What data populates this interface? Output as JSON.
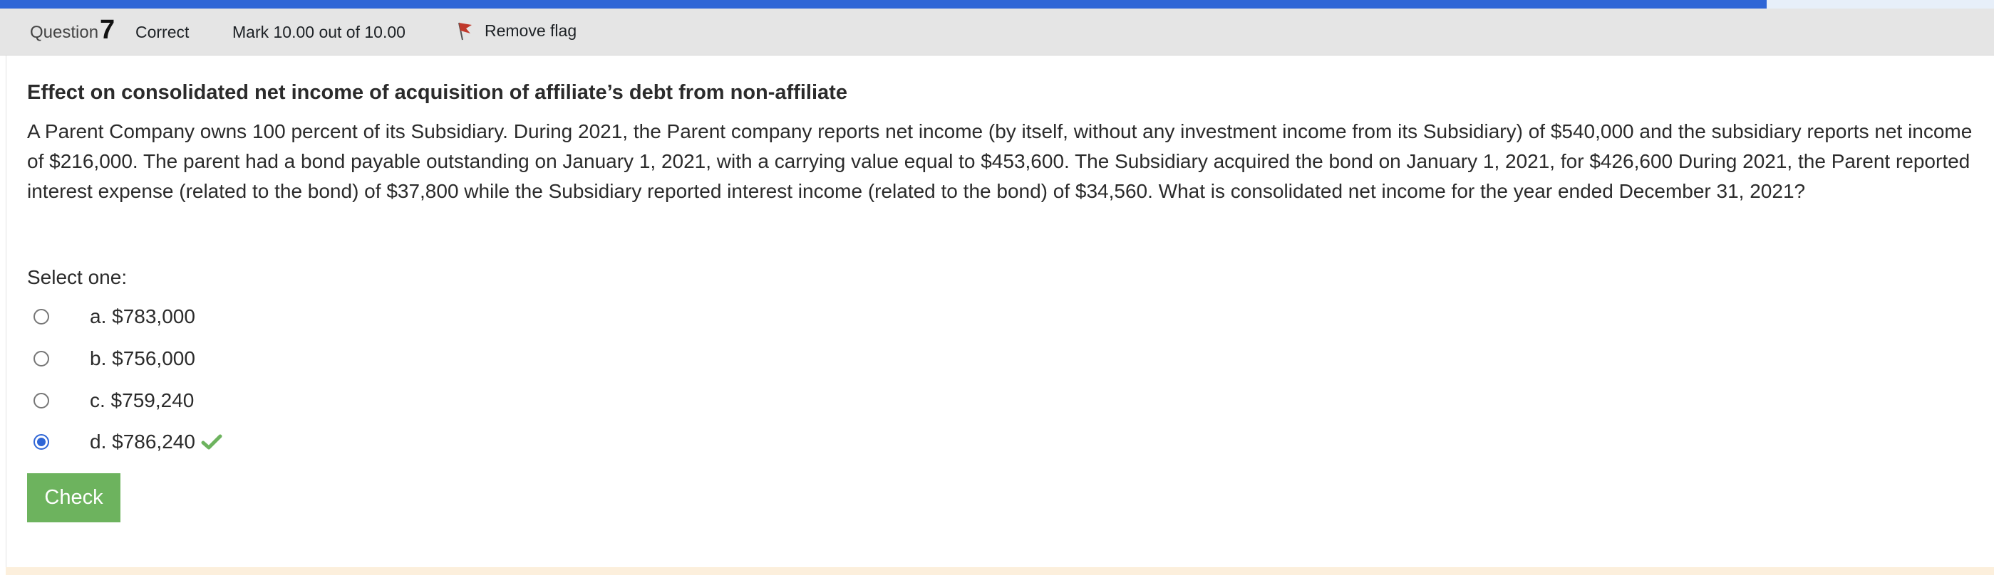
{
  "colors": {
    "accent_blue": "#2f66d6",
    "info_bar_bg": "#e5e5e5",
    "correct_green": "#6db35e",
    "feedback_band": "#fcefdc"
  },
  "progress": {
    "fraction": 0.886
  },
  "info": {
    "question_label": "Question",
    "question_number": "7",
    "state": "Correct",
    "grade": "Mark 10.00 out of 10.00",
    "flag_label": "Remove flag",
    "flag_icon": "flag-icon"
  },
  "question": {
    "title": "Effect on consolidated net income of acquisition of affiliate’s debt from non-affiliate",
    "text": "A Parent Company owns 100 percent of its Subsidiary. During 2021, the Parent company reports net income (by itself, without any investment income from its Subsidiary) of $540,000 and the subsidiary reports net income of $216,000. The parent had a bond payable outstanding on January 1, 2021, with a carrying value equal to $453,600. The Subsidiary acquired the bond on January 1, 2021, for $426,600 During 2021, the Parent reported interest expense (related to the bond) of $37,800 while the Subsidiary reported interest income (related to the bond) of $34,560. What is consolidated net income for the year ended December 31, 2021?",
    "prompt": "Select one:"
  },
  "answers": [
    {
      "label": "a. $783,000",
      "selected": false
    },
    {
      "label": "b. $756,000",
      "selected": false
    },
    {
      "label": "c. $759,240",
      "selected": false
    },
    {
      "label": "d. $786,240",
      "selected": true,
      "icon": "checkmark-icon"
    }
  ],
  "buttons": {
    "check_label": "Check"
  }
}
